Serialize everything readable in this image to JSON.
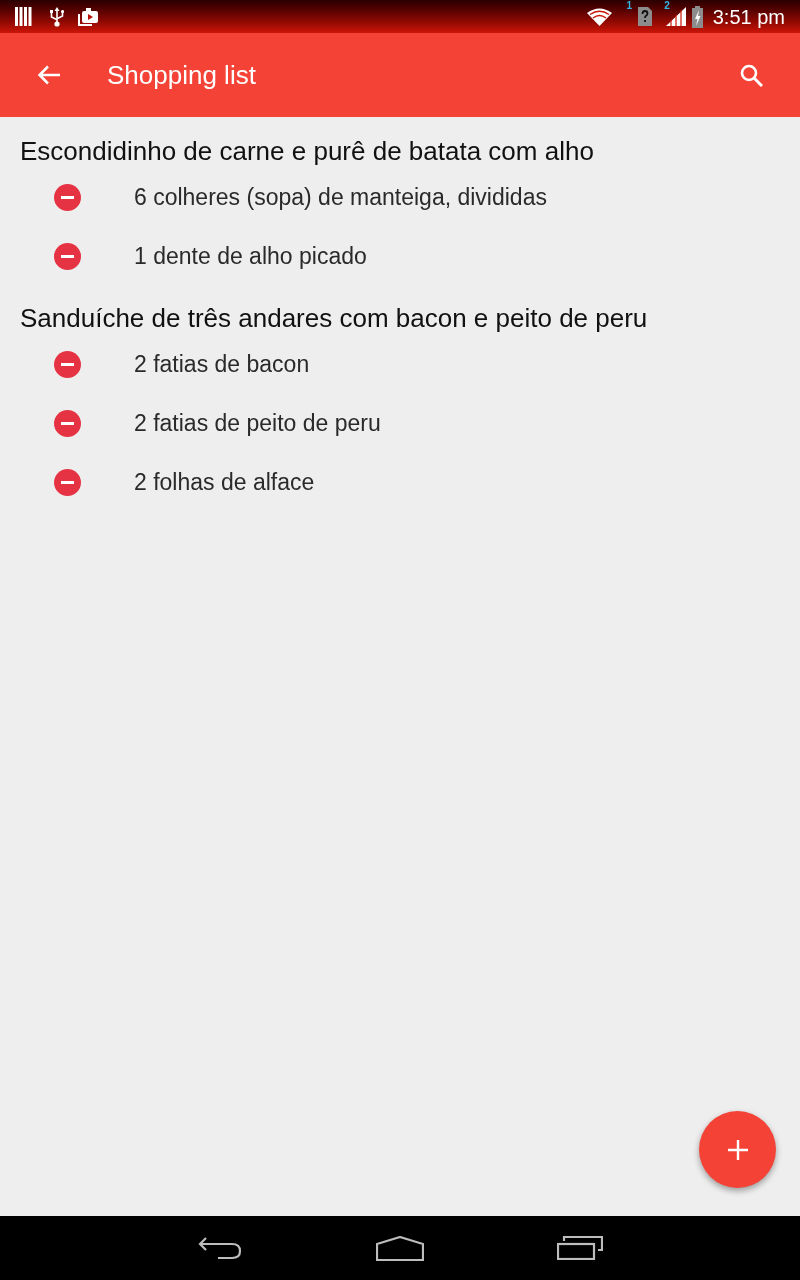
{
  "status_bar": {
    "sim_1_label": "1",
    "sim_2_label": "2",
    "time": "3:51 pm"
  },
  "app_bar": {
    "title": "Shopping list"
  },
  "recipes": [
    {
      "title": "Escondidinho de carne e purê de batata com alho",
      "items": [
        {
          "text": "6 colheres (sopa) de manteiga, divididas"
        },
        {
          "text": "1 dente de alho picado"
        }
      ]
    },
    {
      "title": "Sanduíche de três andares com bacon e peito de peru",
      "items": [
        {
          "text": "2 fatias de bacon"
        },
        {
          "text": "2 fatias de peito de peru"
        },
        {
          "text": "2 folhas de alface"
        }
      ]
    }
  ]
}
